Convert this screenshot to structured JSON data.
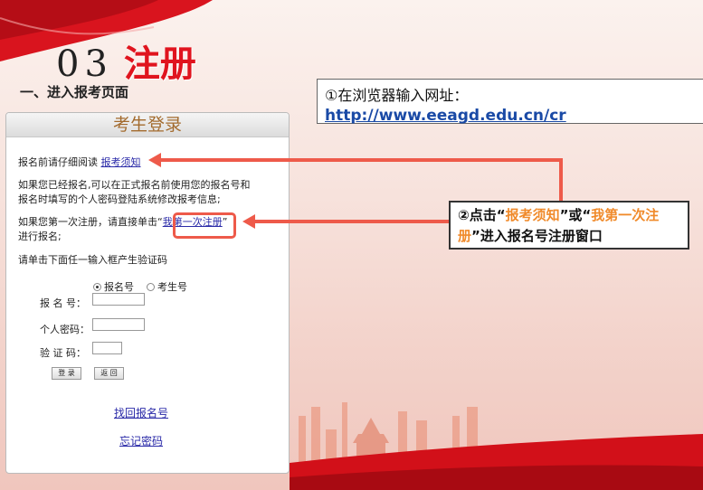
{
  "slide": {
    "number": "03",
    "title": "注册",
    "section_heading": "一、进入报考页面"
  },
  "callout_1": {
    "line1": "①在浏览器输入网址：",
    "url": "http://www.eeagd.edu.cn/cr"
  },
  "callout_2": {
    "prefix": "②点击“",
    "link1": "报考须知",
    "mid": "”或“",
    "link2": "我第一次注册",
    "suffix": "”进入报名号注册窗口"
  },
  "login": {
    "title": "考生登录",
    "read_prompt": "报名前请仔细阅读",
    "notice_link": "报考须知",
    "registered_line1": "如果您已经报名,可以在正式报名前使用您的报名号和",
    "registered_line2": "报名时填写的个人密码登陆系统修改报考信息;",
    "first_line1": "如果您第一次注册，请直接单击“",
    "first_link": "我第一次注册",
    "first_close": "”",
    "first_line2": "进行报名;",
    "captcha_prompt": "请单击下面任一输入框产生验证码",
    "radio_reg_no": "报名号",
    "radio_exam_no": "考生号",
    "label_reg_no": "报 名 号：",
    "label_password": "个人密码：",
    "label_captcha": "验 证 码：",
    "login_button": "登 录",
    "back_button": "返 回",
    "recover_link": "找回报名号",
    "forgot_link": "忘记密码"
  },
  "colors": {
    "accent_red": "#e0141e",
    "highlight_orange": "#f08a2a",
    "arrow_red": "#ee5a4a",
    "url_blue": "#1a4aa6"
  }
}
